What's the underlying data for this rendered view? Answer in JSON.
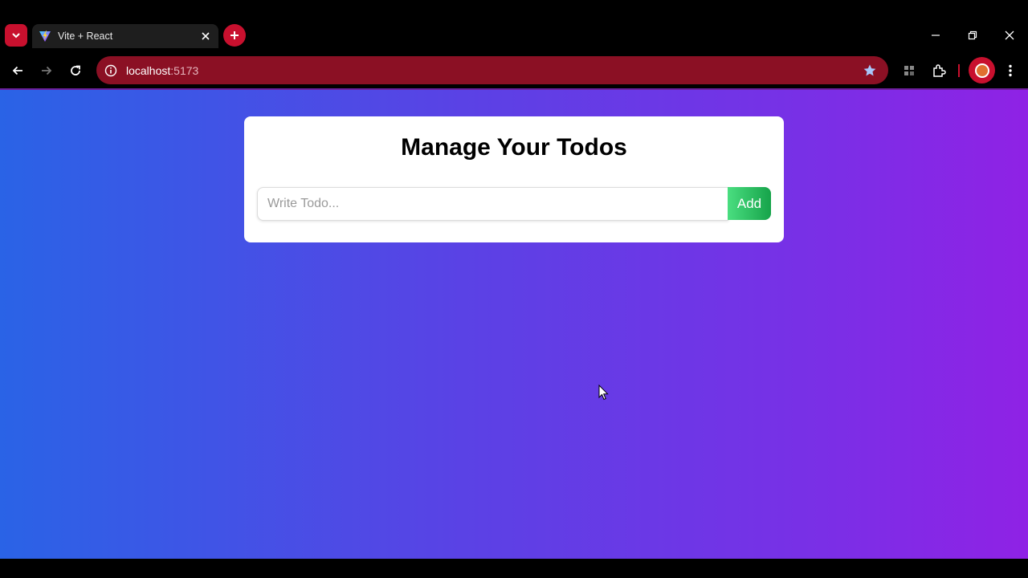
{
  "browser": {
    "tab": {
      "title": "Vite + React"
    },
    "address_bar": {
      "host": "localhost",
      "port": ":5173"
    }
  },
  "page": {
    "heading": "Manage Your Todos",
    "todo_input": {
      "placeholder": "Write Todo...",
      "value": ""
    },
    "add_button_label": "Add"
  },
  "colors": {
    "accent": "#c8102e",
    "omnibox": "#8b1024",
    "gradient_start": "#2a63e6",
    "gradient_end": "#8f22e5",
    "add_button": "#22c55e"
  }
}
